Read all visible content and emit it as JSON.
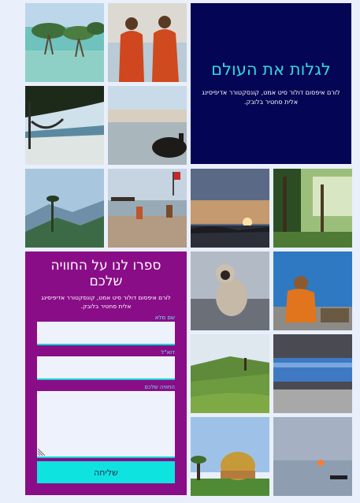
{
  "hero": {
    "title": "לגלות את העולם",
    "text": "לורם איפסום דולור סיט אמט, קונסקטורר אדיפיסינג אלית סחטיר בלובק."
  },
  "form": {
    "title": "ספרו לנו על החוויה שלכם",
    "intro": "לורם איפסום דולור סיט אמט, קונסקטורר אדיפיסינג אלית סחטיר בלובק.",
    "name_label": "שם מלא",
    "email_label": "דוא\"ל",
    "experience_label": "החוויה שלכם",
    "name_value": "",
    "email_value": "",
    "experience_value": "",
    "submit_label": "שליחה"
  },
  "colors": {
    "hero_bg": "#050556",
    "hero_title": "#2fd9de",
    "form_bg": "#8a0d88",
    "button": "#0fe3e0",
    "page_bg": "#e9effb"
  },
  "gallery": [
    "mangrove-photo",
    "monks-photo",
    "hammock-photo",
    "cow-riverbank-photo",
    "misty-hills-photo",
    "beach-fishermen-photo",
    "sunset-lake-photo",
    "palm-forest-photo",
    "monkey-photo",
    "sadhu-photo",
    "tea-plantation-photo",
    "train-photo",
    "golden-dome-photo",
    "river-sunset-boat-photo"
  ]
}
